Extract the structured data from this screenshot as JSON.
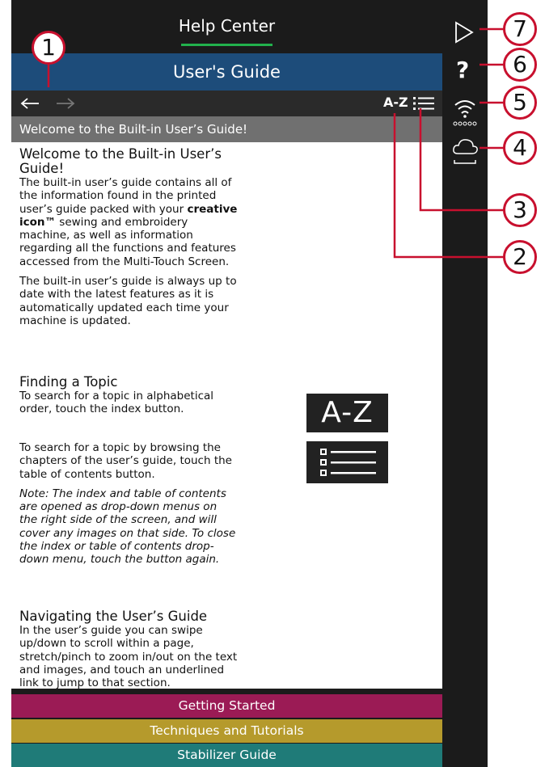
{
  "header": {
    "title": "Help Center"
  },
  "guide_bar": {
    "title": "User's Guide"
  },
  "toolbar": {
    "az_label": "A-Z"
  },
  "page_heading": "Welcome to the Built-in User’s Guide!",
  "content": {
    "welcome_title": "Welcome to the Built-in User’s Guide!",
    "welcome_p1_a": "The built-in user’s guide contains all of the information found in the printed user’s guide packed with your ",
    "welcome_p1_bold": "creative icon™",
    "welcome_p1_b": " sewing and embroidery machine, as well as information regarding all the functions and features accessed from the Multi-Touch Screen.",
    "welcome_p2": "The built-in user’s guide is always up to date with the latest features as it is automatically updated each time your machine is updated.",
    "finding_title": "Finding a Topic",
    "finding_p1": "To search for a topic in alphabetical order, touch the index button.",
    "finding_p2": "To search for a topic by browsing the chapters of the user’s guide, touch the table of contents button.",
    "finding_note": "Note: The index and table of contents are opened as drop-down menus on the right side of the screen, and will cover any images on that side. To close the index or table of contents drop-down menu, touch the button again.",
    "nav_title": "Navigating the User’s Guide",
    "nav_p1": "In the user’s guide you can swipe up/down to scroll within a page, stretch/pinch to zoom in/out on the text and images, and touch an underlined link to jump to that section.",
    "big_az": "A-Z"
  },
  "chapters": [
    {
      "label": "Getting Started",
      "color": "#9b1b55"
    },
    {
      "label": "Techniques and Tutorials",
      "color": "#b59a2c"
    },
    {
      "label": "Stabilizer Guide",
      "color": "#1f7b78"
    }
  ],
  "sidebar": {
    "icons": [
      "play-icon",
      "help-icon",
      "wifi-icon",
      "cloud-icon"
    ]
  },
  "callouts": [
    "1",
    "2",
    "3",
    "4",
    "5",
    "6",
    "7"
  ],
  "colors": {
    "accent_red": "#c8102e",
    "tab_underline": "#22b14c",
    "guide_bar": "#1d4c7a"
  }
}
